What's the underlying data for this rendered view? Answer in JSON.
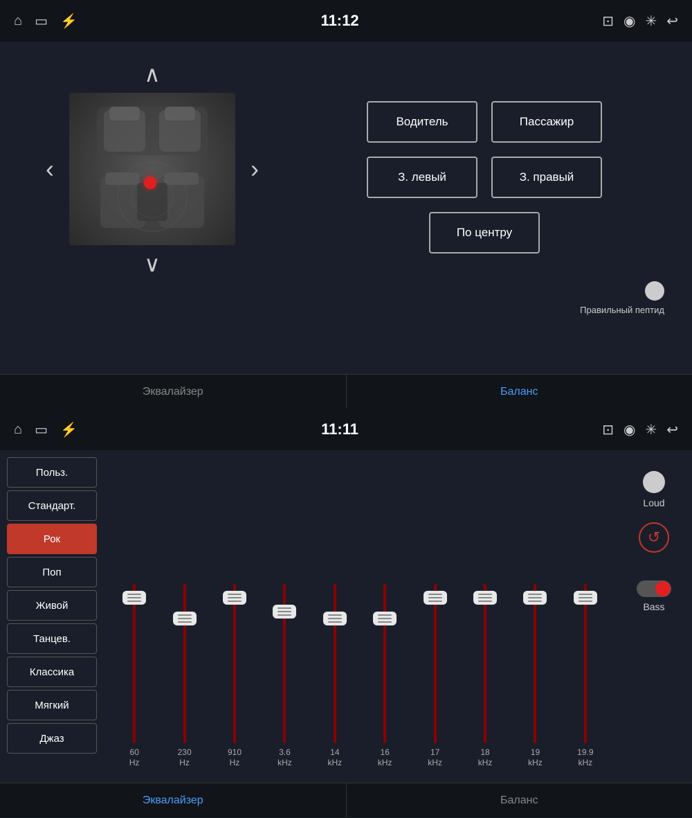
{
  "top_panel": {
    "status_bar": {
      "time": "11:12",
      "icons_left": [
        "home",
        "screen",
        "usb"
      ],
      "icons_right": [
        "cast",
        "location",
        "bluetooth",
        "back"
      ]
    },
    "seat_image_alt": "Car interior seat view",
    "arrows": {
      "up": "∧",
      "down": "∨",
      "left": "‹",
      "right": "›"
    },
    "buttons": {
      "driver": "Водитель",
      "passenger": "Пассажир",
      "rear_left": "З. левый",
      "rear_right": "З. правый",
      "center": "По центру"
    },
    "toggle_label": "Правильный пептид",
    "tabs": {
      "equalizer": "Эквалайзер",
      "balance": "Баланс",
      "active_tab": "balance"
    }
  },
  "bottom_panel": {
    "status_bar": {
      "time": "11:11",
      "icons_left": [
        "home",
        "screen",
        "usb"
      ],
      "icons_right": [
        "cast",
        "location",
        "bluetooth",
        "back"
      ]
    },
    "presets": [
      {
        "label": "Польз.",
        "selected": false
      },
      {
        "label": "Стандарт.",
        "selected": false
      },
      {
        "label": "Рок",
        "selected": true
      },
      {
        "label": "Поп",
        "selected": false
      },
      {
        "label": "Живой",
        "selected": false
      },
      {
        "label": "Танцев.",
        "selected": false
      },
      {
        "label": "Классика",
        "selected": false
      },
      {
        "label": "Мягкий",
        "selected": false
      },
      {
        "label": "Джаз",
        "selected": false
      }
    ],
    "sliders": [
      {
        "freq": "60",
        "unit": "Hz",
        "position": 10
      },
      {
        "freq": "230",
        "unit": "Hz",
        "position": 40
      },
      {
        "freq": "910",
        "unit": "Hz",
        "position": 10
      },
      {
        "freq": "3.6",
        "unit": "kHz",
        "position": 30
      },
      {
        "freq": "14",
        "unit": "kHz",
        "position": 40
      },
      {
        "freq": "16",
        "unit": "kHz",
        "position": 40
      },
      {
        "freq": "17",
        "unit": "kHz",
        "position": 10
      },
      {
        "freq": "18",
        "unit": "kHz",
        "position": 10
      },
      {
        "freq": "19",
        "unit": "kHz",
        "position": 10
      },
      {
        "freq": "19.9",
        "unit": "kHz",
        "position": 10
      }
    ],
    "controls": {
      "loud_label": "Loud",
      "reset_icon": "↺",
      "bass_label": "Bass"
    },
    "tabs": {
      "equalizer": "Эквалайзер",
      "balance": "Баланс",
      "active_tab": "equalizer"
    }
  }
}
